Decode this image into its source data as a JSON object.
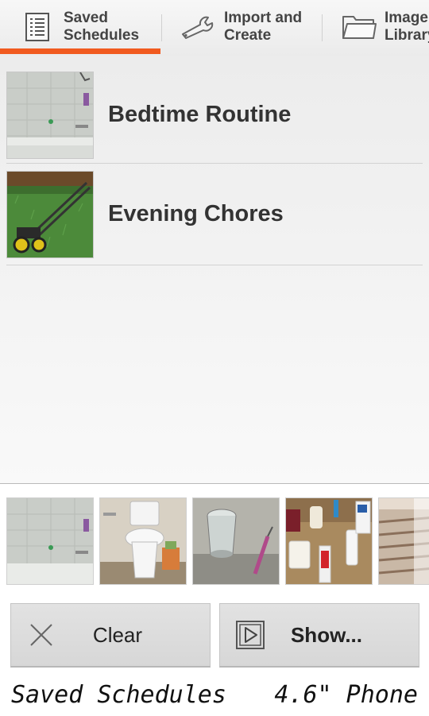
{
  "tabs": [
    {
      "label": "Saved\nSchedules",
      "icon": "list-document-icon",
      "selected": true
    },
    {
      "label": "Import and\nCreate",
      "icon": "wrench-icon",
      "selected": false
    },
    {
      "label": "Image\nLibrary",
      "icon": "folder-icon",
      "selected": false
    }
  ],
  "colors": {
    "accent": "#f15a1f"
  },
  "schedules": [
    {
      "title": "Bedtime Routine",
      "thumbnail": "bathtub"
    },
    {
      "title": "Evening Chores",
      "thumbnail": "lawn-mower"
    }
  ],
  "image_strip": [
    "bathtub",
    "toilet",
    "glass-of-water",
    "toothbrush-and-toothpaste",
    "bed"
  ],
  "buttons": {
    "clear": {
      "label": "Clear",
      "icon": "close-x-icon"
    },
    "show": {
      "label": "Show...",
      "icon": "play-icon"
    }
  },
  "caption": {
    "left": "Saved Schedules",
    "right": "4.6\" Phone"
  }
}
